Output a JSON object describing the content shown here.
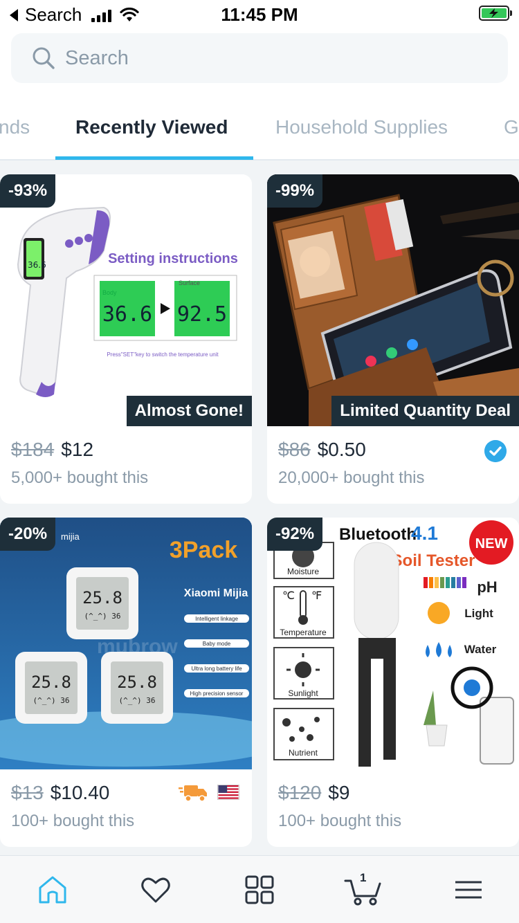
{
  "status_bar": {
    "back_label": "Search",
    "time": "11:45 PM"
  },
  "search": {
    "placeholder": "Search"
  },
  "tabs": [
    {
      "label": "nds"
    },
    {
      "label": "Recently Viewed"
    },
    {
      "label": "Household Supplies"
    },
    {
      "label": "G"
    }
  ],
  "products": [
    {
      "discount": "-93%",
      "banner": "Almost Gone!",
      "price_old": "$184",
      "price_new": "$12",
      "bought": "5,000+ bought this",
      "image_text": {
        "heading": "Setting instructions",
        "readout_body_label": "Body",
        "readout_body": "36.6",
        "readout_surface_label": "Surface",
        "readout_surface": "92.5",
        "gun_readout": "36.6",
        "caption": "Press\"SET\"key to switch the temperature unit"
      }
    },
    {
      "discount": "-99%",
      "banner": "Limited Quantity Deal",
      "price_old": "$86",
      "price_new": "$0.50",
      "bought": "20,000+ bought this",
      "verified_icon": "verified-check-icon"
    },
    {
      "discount": "-20%",
      "price_old": "$13",
      "price_new": "$10.40",
      "bought": "100+ bought this",
      "shipping_icon": "fast-shipping-truck-icon",
      "flag_icon": "us-flag-icon",
      "image_text": {
        "brand": "mijia",
        "pack": "3Pack",
        "title": "Xiaomi Mijia",
        "features": [
          "Intelligent linkage",
          "Baby mode",
          "Ultra long battery life",
          "High precision sensor"
        ],
        "readout": "25.8",
        "readout_sub": "(^_^) 36",
        "watermark": "mubrow"
      }
    },
    {
      "discount": "-92%",
      "price_old": "$120",
      "price_new": "$9",
      "bought": "100+ bought this",
      "image_text": {
        "bluetooth": "Bluetooth",
        "version": "4.1",
        "new_badge": "NEW",
        "title": "Soil Tester",
        "ph": "pH",
        "light": "Light",
        "water": "Water",
        "icons": [
          "Moisture",
          "Temperature",
          "Sunlight",
          "Nutrient"
        ],
        "celsius": "℃",
        "fahrenheit": "℉"
      }
    }
  ],
  "bottom_nav": {
    "items": [
      "home-icon",
      "heart-icon",
      "categories-icon",
      "cart-icon",
      "menu-icon"
    ],
    "cart_count": "1",
    "active": "home-icon",
    "accent": "#2fb7ec"
  },
  "colors": {
    "accent": "#2fb7ec",
    "badge_bg": "#1e2f3a",
    "muted_text": "#8a9aa8"
  }
}
